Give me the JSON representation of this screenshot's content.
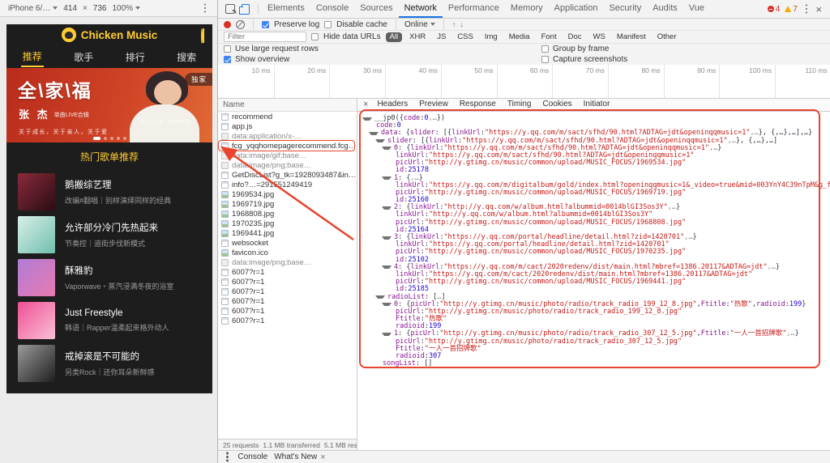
{
  "colors": {
    "app_accent": "#ffcd32",
    "annotation": "#e8442e",
    "devtools_accent": "#1a73e8",
    "record_red": "#d93025"
  },
  "device_toolbar": {
    "device": "iPhone 6/…",
    "width": "414",
    "times": "×",
    "height": "736",
    "zoom": "100%"
  },
  "devtools": {
    "tabs": [
      "Elements",
      "Console",
      "Sources",
      "Network",
      "Performance",
      "Memory",
      "Application",
      "Security",
      "Audits",
      "Vue"
    ],
    "active_tab": "Network",
    "error_count": "4",
    "warning_count": "7",
    "network_toolbar": {
      "preserve_log": "Preserve log",
      "disable_cache": "Disable cache",
      "throttle": "Online",
      "filter_placeholder": "Filter",
      "hide_data_urls": "Hide data URLs",
      "filters": [
        "All",
        "XHR",
        "JS",
        "CSS",
        "Img",
        "Media",
        "Font",
        "Doc",
        "WS",
        "Manifest",
        "Other"
      ],
      "use_large_rows": "Use large request rows",
      "group_by_frame": "Group by frame",
      "show_overview": "Show overview",
      "capture_screenshots": "Capture screenshots"
    },
    "overview_ticks": [
      "10 ms",
      "20 ms",
      "30 ms",
      "40 ms",
      "50 ms",
      "60 ms",
      "70 ms",
      "80 ms",
      "90 ms",
      "100 ms",
      "110 ms"
    ],
    "requests_header": "Name",
    "requests": [
      {
        "name": "recommend",
        "type": "doc"
      },
      {
        "name": "app.js",
        "type": "doc"
      },
      {
        "name": "data:application/x-…",
        "type": "data",
        "gray": true
      },
      {
        "name": "fcg_yqqhomepagerecommend.fcg?g_tk=19…",
        "type": "doc",
        "highlight": true
      },
      {
        "name": "data:image/gif;base…",
        "type": "data",
        "gray": true
      },
      {
        "name": "data:image/png;base…",
        "type": "data",
        "gray": true
      },
      {
        "name": "GetDiscList?g_tk=1928093487&inCharset=u…",
        "type": "doc"
      },
      {
        "name": "info?…=291551249419",
        "type": "doc"
      },
      {
        "name": "1969534.jpg",
        "type": "img"
      },
      {
        "name": "1969719.jpg",
        "type": "img"
      },
      {
        "name": "1968808.jpg",
        "type": "img"
      },
      {
        "name": "1970235.jpg",
        "type": "img"
      },
      {
        "name": "1969441.jpg",
        "type": "img"
      },
      {
        "name": "websocket",
        "type": "doc"
      },
      {
        "name": "favicon.ico",
        "type": "img"
      },
      {
        "name": "data:image/png;base…",
        "type": "data",
        "gray": true
      },
      {
        "name": "6007?r=1",
        "type": "doc"
      },
      {
        "name": "6007?r=1",
        "type": "doc"
      },
      {
        "name": "6007?r=1",
        "type": "doc"
      },
      {
        "name": "6007?r=1",
        "type": "doc"
      },
      {
        "name": "6007?r=1",
        "type": "doc"
      },
      {
        "name": "6007?r=1",
        "type": "doc"
      }
    ],
    "panel_tabs": [
      "Headers",
      "Preview",
      "Response",
      "Timing",
      "Cookies",
      "Initiator"
    ],
    "active_panel_tab": "Preview",
    "status": [
      "25 requests",
      "1.1 MB transferred",
      "5.1 MB resources"
    ],
    "drawer": {
      "tab1": "Console",
      "tab2": "What's New"
    }
  },
  "preview_lines": [
    {
      "i": 0,
      "a": 1,
      "t": [
        [
          "p",
          "__jp0({"
        ],
        [
          "k",
          "code"
        ],
        [
          "p",
          ": "
        ],
        [
          "n",
          "0"
        ],
        [
          "d",
          ",…"
        ],
        [
          "p",
          "})"
        ]
      ]
    },
    {
      "i": 1,
      "a": 0,
      "t": [
        [
          "k",
          "code"
        ],
        [
          "p",
          ": "
        ],
        [
          "n",
          "0"
        ]
      ]
    },
    {
      "i": 1,
      "a": 1,
      "t": [
        [
          "k",
          "data"
        ],
        [
          "p",
          ": {"
        ],
        [
          "k",
          "slider"
        ],
        [
          "p",
          ": [{"
        ],
        [
          "k",
          "linkUrl"
        ],
        [
          "p",
          ": "
        ],
        [
          "s",
          "\"https://y.qq.com/m/sact/sfhd/90.html?ADTAG=jdt&openinqqmusic=1\""
        ],
        [
          "d",
          ",…"
        ],
        [
          "p",
          "}, {,…},…],…}"
        ]
      ]
    },
    {
      "i": 2,
      "a": 1,
      "t": [
        [
          "k",
          "slider"
        ],
        [
          "p",
          ": [{"
        ],
        [
          "k",
          "linkUrl"
        ],
        [
          "p",
          ": "
        ],
        [
          "s",
          "\"https://y.qq.com/m/sact/sfhd/90.html?ADTAG=jdt&openinqqmusic=1\""
        ],
        [
          "d",
          ",…"
        ],
        [
          "p",
          "}, {,…},…]"
        ]
      ]
    },
    {
      "i": 3,
      "a": 1,
      "t": [
        [
          "k",
          "0"
        ],
        [
          "p",
          ": {"
        ],
        [
          "k",
          "linkUrl"
        ],
        [
          "p",
          ": "
        ],
        [
          "s",
          "\"https://y.qq.com/m/sact/sfhd/90.html?ADTAG=jdt&openinqqmusic=1\""
        ],
        [
          "d",
          ",…"
        ],
        [
          "p",
          "}"
        ]
      ]
    },
    {
      "i": 4,
      "a": 0,
      "t": [
        [
          "k",
          "linkUrl"
        ],
        [
          "p",
          ": "
        ],
        [
          "s",
          "\"https://y.qq.com/m/sact/sfhd/90.html?ADTAG=jdt&openinqqmusic=1\""
        ]
      ]
    },
    {
      "i": 4,
      "a": 0,
      "t": [
        [
          "k",
          "picUrl"
        ],
        [
          "p",
          ": "
        ],
        [
          "s",
          "\"http://y.gtimg.cn/music/common/upload/MUSIC_FOCUS/1969534.jpg\""
        ]
      ]
    },
    {
      "i": 4,
      "a": 0,
      "t": [
        [
          "k",
          "id"
        ],
        [
          "p",
          ": "
        ],
        [
          "n",
          "25178"
        ]
      ]
    },
    {
      "i": 3,
      "a": 1,
      "t": [
        [
          "k",
          "1"
        ],
        [
          "p",
          ": {"
        ],
        [
          "d",
          ",…"
        ],
        [
          "p",
          "}"
        ]
      ]
    },
    {
      "i": 4,
      "a": 0,
      "t": [
        [
          "k",
          "linkUrl"
        ],
        [
          "p",
          ": "
        ],
        [
          "s",
          "\"https://y.qq.com/m/digitalbum/gold/index.html?openinqqmusic=1&_video=true&mid=003YnY4C39nTpM&g_f=shoujijiaodian\""
        ]
      ]
    },
    {
      "i": 4,
      "a": 0,
      "t": [
        [
          "k",
          "picUrl"
        ],
        [
          "p",
          ": "
        ],
        [
          "s",
          "\"http://y.gtimg.cn/music/common/upload/MUSIC_FOCUS/1969719.jpg\""
        ]
      ]
    },
    {
      "i": 4,
      "a": 0,
      "t": [
        [
          "k",
          "id"
        ],
        [
          "p",
          ": "
        ],
        [
          "n",
          "25160"
        ]
      ]
    },
    {
      "i": 3,
      "a": 1,
      "t": [
        [
          "k",
          "2"
        ],
        [
          "p",
          ": {"
        ],
        [
          "k",
          "linkUrl"
        ],
        [
          "p",
          ": "
        ],
        [
          "s",
          "\"http://y.qq.com/w/album.html?albummid=0014blGI3Sos3Y\""
        ],
        [
          "d",
          ",…"
        ],
        [
          "p",
          "}"
        ]
      ]
    },
    {
      "i": 4,
      "a": 0,
      "t": [
        [
          "k",
          "linkUrl"
        ],
        [
          "p",
          ": "
        ],
        [
          "s",
          "\"http://y.qq.com/w/album.html?albummid=0014blGI3Sos3Y\""
        ]
      ]
    },
    {
      "i": 4,
      "a": 0,
      "t": [
        [
          "k",
          "picUrl"
        ],
        [
          "p",
          ": "
        ],
        [
          "s",
          "\"http://y.gtimg.cn/music/common/upload/MUSIC_FOCUS/1968808.jpg\""
        ]
      ]
    },
    {
      "i": 4,
      "a": 0,
      "t": [
        [
          "k",
          "id"
        ],
        [
          "p",
          ": "
        ],
        [
          "n",
          "25164"
        ]
      ]
    },
    {
      "i": 3,
      "a": 1,
      "t": [
        [
          "k",
          "3"
        ],
        [
          "p",
          ": {"
        ],
        [
          "k",
          "linkUrl"
        ],
        [
          "p",
          ": "
        ],
        [
          "s",
          "\"https://y.qq.com/portal/headline/detail.html?zid=1420701\""
        ],
        [
          "d",
          ",…"
        ],
        [
          "p",
          "}"
        ]
      ]
    },
    {
      "i": 4,
      "a": 0,
      "t": [
        [
          "k",
          "linkUrl"
        ],
        [
          "p",
          ": "
        ],
        [
          "s",
          "\"https://y.qq.com/portal/headline/detail.html?zid=1420701\""
        ]
      ]
    },
    {
      "i": 4,
      "a": 0,
      "t": [
        [
          "k",
          "picUrl"
        ],
        [
          "p",
          ": "
        ],
        [
          "s",
          "\"http://y.gtimg.cn/music/common/upload/MUSIC_FOCUS/1970235.jpg\""
        ]
      ]
    },
    {
      "i": 4,
      "a": 0,
      "t": [
        [
          "k",
          "id"
        ],
        [
          "p",
          ": "
        ],
        [
          "n",
          "25102"
        ]
      ]
    },
    {
      "i": 3,
      "a": 1,
      "t": [
        [
          "k",
          "4"
        ],
        [
          "p",
          ": {"
        ],
        [
          "k",
          "linkUrl"
        ],
        [
          "p",
          ": "
        ],
        [
          "s",
          "\"https://y.qq.com/m/cact/2020redenv/dist/main.html?mbref=1386.20117&ADTAG=jdt\""
        ],
        [
          "d",
          ",…"
        ],
        [
          "p",
          "}"
        ]
      ]
    },
    {
      "i": 4,
      "a": 0,
      "t": [
        [
          "k",
          "linkUrl"
        ],
        [
          "p",
          ": "
        ],
        [
          "s",
          "\"https://y.qq.com/m/cact/2020redenv/dist/main.html?mbref=1386.20117&ADTAG=jdt\""
        ]
      ]
    },
    {
      "i": 4,
      "a": 0,
      "t": [
        [
          "k",
          "picUrl"
        ],
        [
          "p",
          ": "
        ],
        [
          "s",
          "\"http://y.gtimg.cn/music/common/upload/MUSIC_FOCUS/1969441.jpg\""
        ]
      ]
    },
    {
      "i": 4,
      "a": 0,
      "t": [
        [
          "k",
          "id"
        ],
        [
          "p",
          ": "
        ],
        [
          "n",
          "25185"
        ]
      ]
    },
    {
      "i": 2,
      "a": 1,
      "t": [
        [
          "k",
          "radioList"
        ],
        [
          "p",
          ": ["
        ],
        [
          "d",
          "…"
        ],
        [
          "p",
          "]"
        ]
      ]
    },
    {
      "i": 3,
      "a": 1,
      "t": [
        [
          "k",
          "0"
        ],
        [
          "p",
          ": {"
        ],
        [
          "k",
          "picUrl"
        ],
        [
          "p",
          ": "
        ],
        [
          "s",
          "\"http://y.gtimg.cn/music/photo/radio/track_radio_199_12_8.jpg\""
        ],
        [
          "p",
          ", "
        ],
        [
          "k",
          "Ftitle"
        ],
        [
          "p",
          ": "
        ],
        [
          "s",
          "\"热歌\""
        ],
        [
          "p",
          ", "
        ],
        [
          "k",
          "radioid"
        ],
        [
          "p",
          ": "
        ],
        [
          "n",
          "199"
        ],
        [
          "p",
          "}"
        ]
      ]
    },
    {
      "i": 4,
      "a": 0,
      "t": [
        [
          "k",
          "picUrl"
        ],
        [
          "p",
          ": "
        ],
        [
          "s",
          "\"http://y.gtimg.cn/music/photo/radio/track_radio_199_12_8.jpg\""
        ]
      ]
    },
    {
      "i": 4,
      "a": 0,
      "t": [
        [
          "k",
          "Ftitle"
        ],
        [
          "p",
          ": "
        ],
        [
          "s",
          "\"热歌\""
        ]
      ]
    },
    {
      "i": 4,
      "a": 0,
      "t": [
        [
          "k",
          "radioid"
        ],
        [
          "p",
          ": "
        ],
        [
          "n",
          "199"
        ]
      ]
    },
    {
      "i": 3,
      "a": 1,
      "t": [
        [
          "k",
          "1"
        ],
        [
          "p",
          ": {"
        ],
        [
          "k",
          "picUrl"
        ],
        [
          "p",
          ": "
        ],
        [
          "s",
          "\"http://y.gtimg.cn/music/photo/radio/track_radio_307_12_5.jpg\""
        ],
        [
          "p",
          ", "
        ],
        [
          "k",
          "Ftitle"
        ],
        [
          "p",
          ": "
        ],
        [
          "s",
          "\"一人一首招牌歌\""
        ],
        [
          "d",
          ",…"
        ],
        [
          "p",
          "}"
        ]
      ]
    },
    {
      "i": 4,
      "a": 0,
      "t": [
        [
          "k",
          "picUrl"
        ],
        [
          "p",
          ": "
        ],
        [
          "s",
          "\"http://y.gtimg.cn/music/photo/radio/track_radio_307_12_5.jpg\""
        ]
      ]
    },
    {
      "i": 4,
      "a": 0,
      "t": [
        [
          "k",
          "Ftitle"
        ],
        [
          "p",
          ": "
        ],
        [
          "s",
          "\"一人一首招牌歌\""
        ]
      ]
    },
    {
      "i": 4,
      "a": 0,
      "t": [
        [
          "k",
          "radioid"
        ],
        [
          "p",
          ": "
        ],
        [
          "n",
          "307"
        ]
      ]
    },
    {
      "i": 2,
      "a": 0,
      "t": [
        [
          "k",
          "songList"
        ],
        [
          "p",
          ": []"
        ]
      ]
    }
  ],
  "app": {
    "title": "Chicken Music",
    "tabs": [
      "推荐",
      "歌手",
      "排行",
      "搜索"
    ],
    "active_tab": "推荐",
    "banner": {
      "badge": "独家",
      "headline": "全\\家\\福",
      "artist": "张 杰",
      "artist_sub": "单曲LIVE合辑",
      "caption": "关于成长，关于亲人，关于爱",
      "artist_en": "JASON ZHANG"
    },
    "section_title": "热门歌单推荐",
    "playlists": [
      {
        "title": "鹅搬综艺理",
        "desc": "改编#翻唱｜别样演绎同样的经典",
        "c1": "#8a2a3a",
        "c2": "#2a0d14"
      },
      {
        "title": "允许部分冷门先热起来",
        "desc": "节奏控｜追街步伐新模式",
        "c1": "#d9efe9",
        "c2": "#6fbfae"
      },
      {
        "title": "酥雅豹",
        "desc": "Vaporwave・蒸汽浸满冬夜的浴室",
        "c1": "#b07bd6",
        "c2": "#e87bb0"
      },
      {
        "title": "Just Freestyle",
        "desc": "韩语｜Rapper温柔起来格外动人",
        "c1": "#ef4f93",
        "c2": "#f9c0d8"
      },
      {
        "title": "戒掉滚是不可能的",
        "desc": "另类Rock｜还你耳朵新鲜感",
        "c1": "#9a9a9a",
        "c2": "#1e1e1e"
      }
    ]
  }
}
